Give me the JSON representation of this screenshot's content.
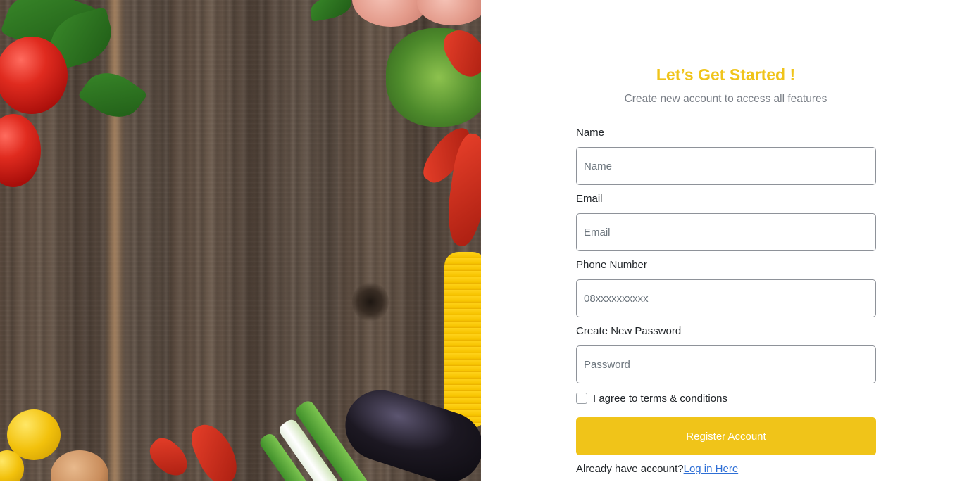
{
  "hero": {
    "image": "food-on-wooden-table"
  },
  "form": {
    "title": "Let’s Get Started !",
    "subtitle": "Create new account to access all features",
    "name": {
      "label": "Name",
      "placeholder": "Name",
      "value": ""
    },
    "email": {
      "label": "Email",
      "placeholder": "Email",
      "value": ""
    },
    "phone": {
      "label": "Phone Number",
      "placeholder": "08xxxxxxxxxx",
      "value": ""
    },
    "password": {
      "label": "Create New Password",
      "placeholder": "Password",
      "value": ""
    },
    "terms": {
      "label": "I agree to terms & conditions",
      "checked": false
    },
    "register_label": "Register Account",
    "login_prompt": "Already have account?",
    "login_link": "Log in Here"
  },
  "colors": {
    "accent": "#f0c419",
    "title": "#f0c41b",
    "link": "#2e6fd6",
    "subtitle": "#7a7f87"
  }
}
